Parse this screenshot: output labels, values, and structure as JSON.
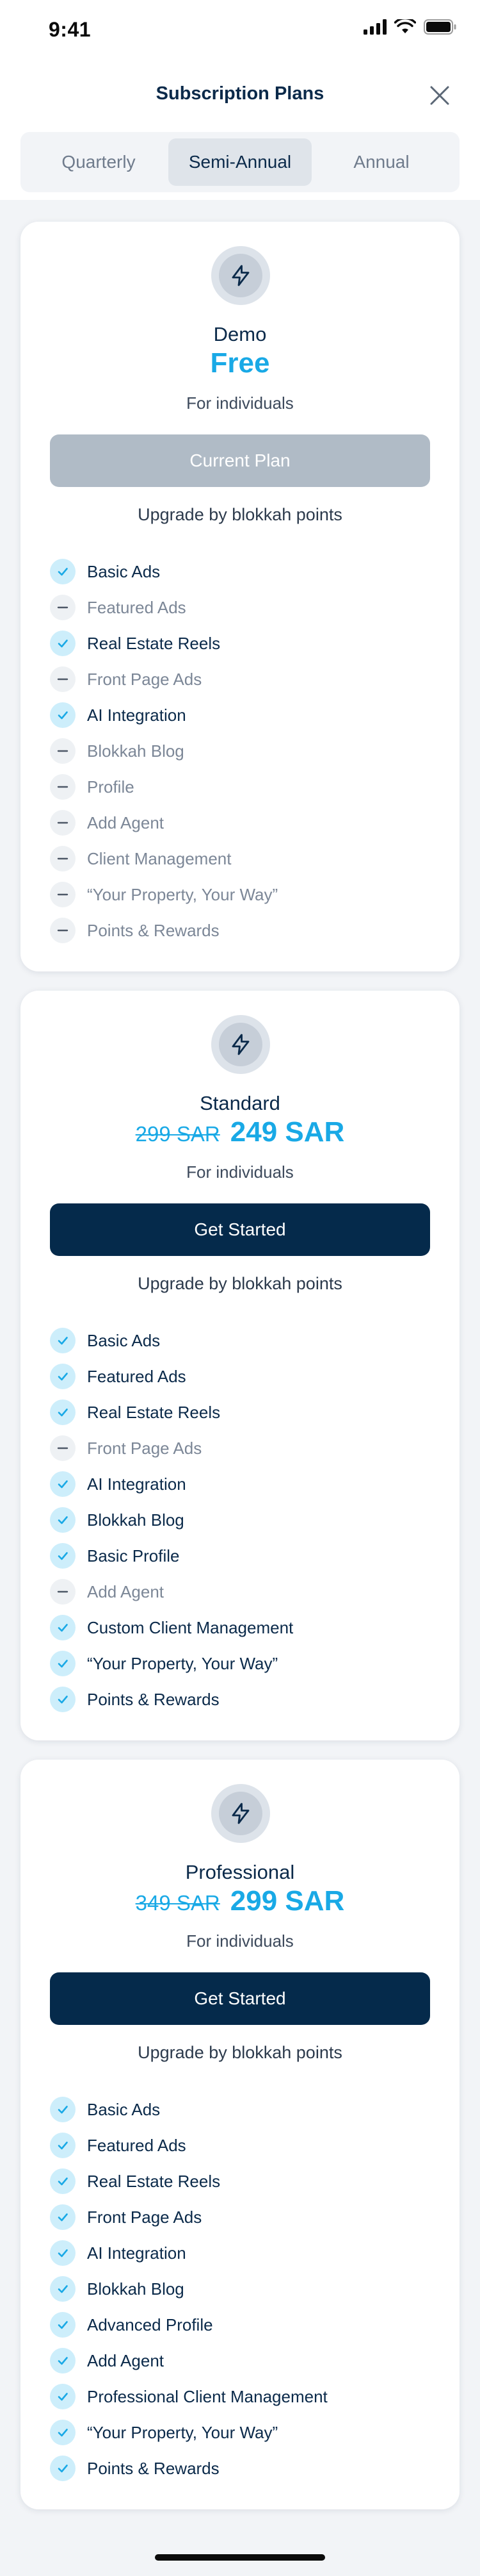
{
  "status_bar": {
    "time": "9:41"
  },
  "header": {
    "title": "Subscription Plans"
  },
  "tabs": [
    {
      "label": "Quarterly",
      "active": false
    },
    {
      "label": "Semi-Annual",
      "active": true
    },
    {
      "label": "Annual",
      "active": false
    }
  ],
  "colors": {
    "accent": "#19a9e6",
    "primary": "#052a4b",
    "disabled": "#b0bbc6",
    "check_bg": "#cdeefb"
  },
  "plans": [
    {
      "icon": "lightning-icon",
      "name": "Demo",
      "old_price": "",
      "price": "Free",
      "audience": "For individuals",
      "cta": "Current Plan",
      "cta_state": "current",
      "upgrade_text": "Upgrade by blokkah points",
      "features": [
        {
          "label": "Basic Ads",
          "included": true
        },
        {
          "label": "Featured Ads",
          "included": false
        },
        {
          "label": "Real Estate Reels",
          "included": true
        },
        {
          "label": "Front Page Ads",
          "included": false
        },
        {
          "label": "AI Integration",
          "included": true
        },
        {
          "label": "Blokkah Blog",
          "included": false
        },
        {
          "label": "Profile",
          "included": false
        },
        {
          "label": "Add Agent",
          "included": false
        },
        {
          "label": "Client Management",
          "included": false
        },
        {
          "label": "“Your Property, Your Way”",
          "included": false
        },
        {
          "label": "Points & Rewards",
          "included": false
        }
      ]
    },
    {
      "icon": "lightning-icon",
      "name": "Standard",
      "old_price": "299 SAR",
      "price": "249 SAR",
      "audience": "For individuals",
      "cta": "Get Started",
      "cta_state": "start",
      "upgrade_text": "Upgrade by blokkah points",
      "features": [
        {
          "label": "Basic Ads",
          "included": true
        },
        {
          "label": "Featured Ads",
          "included": true
        },
        {
          "label": "Real Estate Reels",
          "included": true
        },
        {
          "label": "Front Page Ads",
          "included": false
        },
        {
          "label": "AI Integration",
          "included": true
        },
        {
          "label": "Blokkah Blog",
          "included": true
        },
        {
          "label": "Basic Profile",
          "included": true
        },
        {
          "label": "Add Agent",
          "included": false
        },
        {
          "label": "Custom Client Management",
          "included": true
        },
        {
          "label": "“Your Property, Your Way”",
          "included": true
        },
        {
          "label": "Points & Rewards",
          "included": true
        }
      ]
    },
    {
      "icon": "lightning-icon",
      "name": "Professional",
      "old_price": "349 SAR",
      "price": "299 SAR",
      "audience": "For individuals",
      "cta": "Get Started",
      "cta_state": "start",
      "upgrade_text": "Upgrade by blokkah points",
      "features": [
        {
          "label": "Basic Ads",
          "included": true
        },
        {
          "label": "Featured Ads",
          "included": true
        },
        {
          "label": "Real Estate Reels",
          "included": true
        },
        {
          "label": "Front Page Ads",
          "included": true
        },
        {
          "label": "AI Integration",
          "included": true
        },
        {
          "label": "Blokkah Blog",
          "included": true
        },
        {
          "label": "Advanced Profile",
          "included": true
        },
        {
          "label": "Add Agent",
          "included": true
        },
        {
          "label": "Professional Client Management",
          "included": true
        },
        {
          "label": "“Your Property, Your Way”",
          "included": true
        },
        {
          "label": "Points & Rewards",
          "included": true
        }
      ]
    }
  ]
}
